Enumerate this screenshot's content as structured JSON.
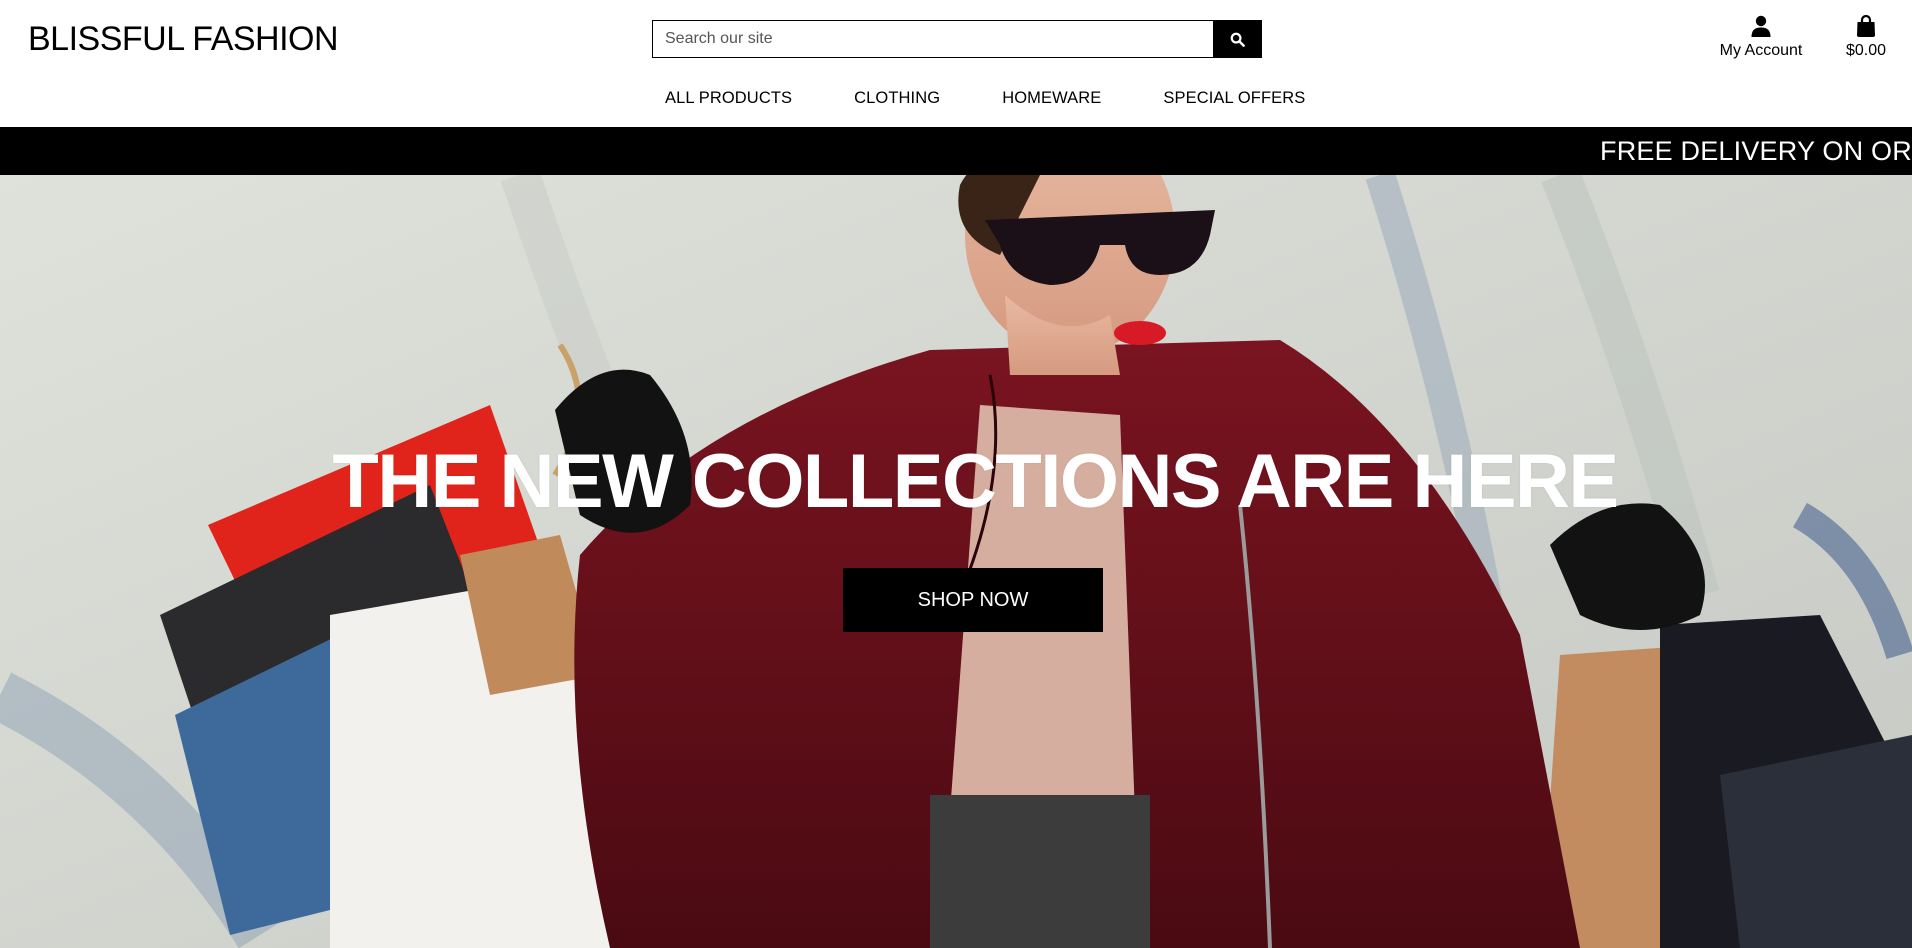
{
  "brand": {
    "name": "BLISSFUL FASHION"
  },
  "search": {
    "placeholder": "Search our site",
    "icon": "search-icon"
  },
  "account": {
    "label": "My Account",
    "icon": "user-icon"
  },
  "bag": {
    "total": "$0.00",
    "icon": "shopping-bag-icon"
  },
  "nav": {
    "items": [
      {
        "label": "ALL PRODUCTS"
      },
      {
        "label": "CLOTHING"
      },
      {
        "label": "HOMEWARE"
      },
      {
        "label": "SPECIAL OFFERS"
      }
    ]
  },
  "banner": {
    "text": "FREE DELIVERY ON ORI"
  },
  "hero": {
    "title": "THE NEW COLLECTIONS ARE HERE",
    "cta": "SHOP NOW"
  },
  "colors": {
    "accent": "#000000",
    "background": "#ffffff",
    "coat": "#6b0f1a"
  }
}
